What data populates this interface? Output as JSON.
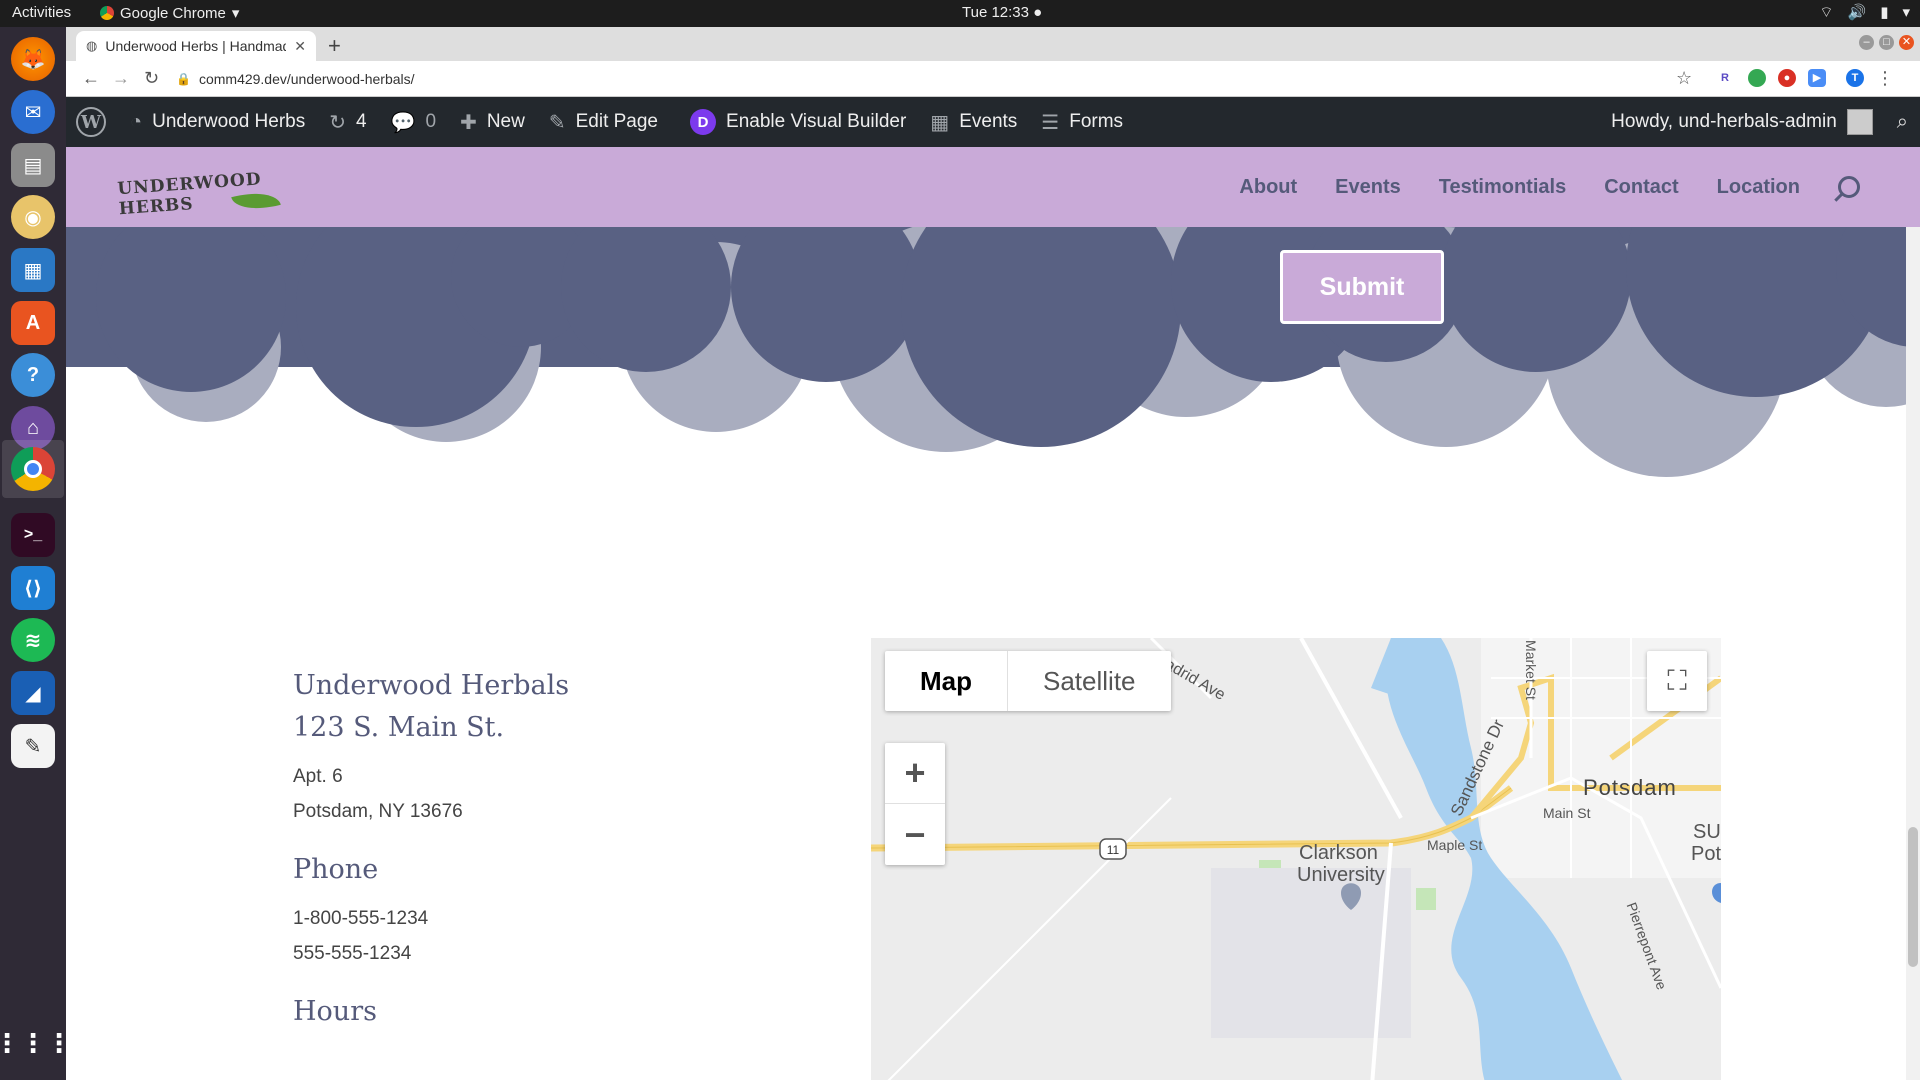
{
  "os": {
    "activities": "Activities",
    "app_menu": "Google Chrome",
    "clock": "Tue 12:33"
  },
  "dock": {
    "items": [
      "firefox-icon",
      "thunderbird-icon",
      "files-icon",
      "rhythmbox-icon",
      "writer-icon",
      "software-icon",
      "help-icon",
      "github-icon",
      "chrome-icon",
      "terminal-icon",
      "vscode-icon",
      "spotify-icon",
      "wireshark-icon",
      "text-editor-icon",
      "apps-grid-icon"
    ]
  },
  "browser": {
    "tab_title": "Underwood Herbs | Handmade",
    "url": "comm429.dev/underwood-herbals/"
  },
  "wpbar": {
    "site_name": "Underwood Herbs",
    "updates_count": "4",
    "comments_count": "0",
    "new_label": "New",
    "edit_label": "Edit Page",
    "visual_builder_label": "Enable Visual Builder",
    "events_label": "Events",
    "forms_label": "Forms",
    "howdy": "Howdy, und-herbals-admin"
  },
  "site": {
    "logo_text": "UNDERWOOD HERBS",
    "nav": [
      "About",
      "Events",
      "Testimontials",
      "Contact",
      "Location"
    ]
  },
  "form": {
    "submit_label": "Submit"
  },
  "contact": {
    "business_name": "Underwood Herbals",
    "street": "123 S. Main St.",
    "apt": "Apt. 6",
    "city": "Potsdam, NY 13676",
    "phone_heading": "Phone",
    "phone1": "1-800-555-1234",
    "phone2": "555-555-1234",
    "hours_heading": "Hours"
  },
  "map": {
    "map_tab": "Map",
    "satellite_tab": "Satellite",
    "labels": {
      "madrid": "Madrid Ave",
      "market": "Market St",
      "sandstone": "Sandstone Dr",
      "potsdam": "Potsdam",
      "main": "Main St",
      "maple": "Maple St",
      "clarkson": "Clarkson",
      "university": "University",
      "su": "SU",
      "pots": "Pots",
      "pierrepont": "Pierrepont Ave",
      "route": "11"
    }
  },
  "colors": {
    "header_purple": "#c9aad8",
    "dark_slate": "#596183",
    "cloud_light": "#a9adbf",
    "text_slate": "#555a7a",
    "water": "#a8d0f0",
    "road": "#f5d57a"
  }
}
